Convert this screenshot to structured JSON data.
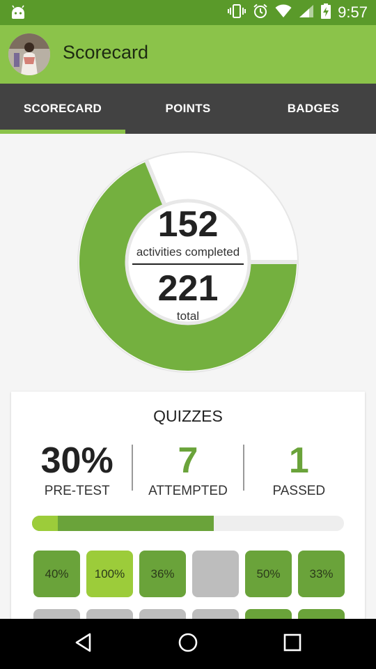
{
  "status_bar": {
    "time": "9:57",
    "icons": [
      "android-debug-icon",
      "vibrate-icon",
      "alarm-icon",
      "wifi-icon",
      "signal-icon",
      "battery-charging-icon"
    ]
  },
  "app_bar": {
    "title": "Scorecard",
    "avatar_icon": "profile-avatar"
  },
  "tabs": [
    {
      "label": "SCORECARD",
      "selected": true
    },
    {
      "label": "POINTS",
      "selected": false
    },
    {
      "label": "BADGES",
      "selected": false
    }
  ],
  "activity": {
    "completed": "152",
    "completed_label": "activities completed",
    "total": "221",
    "total_label": "total",
    "completed_fraction": 0.688
  },
  "quizzes": {
    "title": "QUIZZES",
    "pretest_value": "30%",
    "pretest_label": "PRE-TEST",
    "attempted_value": "7",
    "attempted_label": "ATTEMPTED",
    "passed_value": "1",
    "passed_label": "PASSED",
    "progress": {
      "passed_fraction": 0.0833,
      "attempted_fraction": 0.583
    },
    "tiles_row1": [
      {
        "label": "40%",
        "status": "attempted"
      },
      {
        "label": "100%",
        "status": "passed"
      },
      {
        "label": "36%",
        "status": "attempted"
      },
      {
        "label": "",
        "status": "not-attempted"
      },
      {
        "label": "50%",
        "status": "attempted"
      },
      {
        "label": "33%",
        "status": "attempted"
      }
    ],
    "tiles_row2": [
      {
        "label": "",
        "status": "not-attempted"
      },
      {
        "label": "",
        "status": "not-attempted"
      },
      {
        "label": "",
        "status": "not-attempted"
      },
      {
        "label": "",
        "status": "not-attempted"
      },
      {
        "label": "",
        "status": "attempted"
      },
      {
        "label": "",
        "status": "attempted"
      }
    ]
  },
  "colors": {
    "status_bar": "#5a9a2a",
    "app_bar": "#8bc34a",
    "tab_bar": "#424242",
    "tab_indicator": "#8bc34a",
    "donut_green": "#74b03f",
    "tile_attempted": "#6aa33a",
    "tile_passed": "#9ccc3a",
    "tile_empty": "#bdbdbd",
    "number_green": "#6aa33a"
  },
  "nav_bar": {
    "back_icon": "back-icon",
    "home_icon": "home-icon",
    "recents_icon": "recents-icon"
  }
}
